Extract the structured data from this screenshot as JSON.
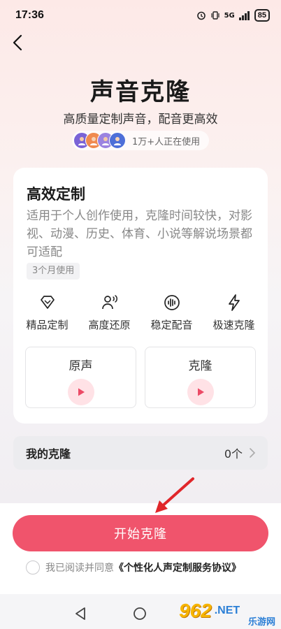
{
  "status_bar": {
    "time": "17:36",
    "network": "5G",
    "battery": "85"
  },
  "header": {
    "title": "声音克隆",
    "subtitle": "高质量定制声音，配音更高效",
    "users_text": "1万+人正在使用",
    "avatar_colors": [
      "#7a63d6",
      "#f08a50",
      "#9b83e0",
      "#4d6fd8"
    ]
  },
  "plan_card": {
    "title": "高效定制",
    "description": "适用于个人创作使用，克隆时间较快，对影视、动漫、历史、体育、小说等解说场景都可适配",
    "tag": "3个月使用",
    "features": [
      {
        "icon": "diamond-icon",
        "label": "精品定制"
      },
      {
        "icon": "voice-person-icon",
        "label": "高度还原"
      },
      {
        "icon": "waveform-icon",
        "label": "稳定配音"
      },
      {
        "icon": "lightning-icon",
        "label": "极速克隆"
      }
    ],
    "samples": [
      {
        "label": "原声"
      },
      {
        "label": "克隆"
      }
    ]
  },
  "my_clone": {
    "label": "我的克隆",
    "count": "0个"
  },
  "action": {
    "start_label": "开始克隆",
    "agree_prefix": "我已阅读并同意",
    "agree_link": "《个性化人声定制服务协议》"
  },
  "watermark": {
    "logo": "962",
    "suffix": ".NET",
    "sub": "乐游网"
  },
  "colors": {
    "accent": "#f0546c",
    "play_bg": "#ffe2e6"
  }
}
